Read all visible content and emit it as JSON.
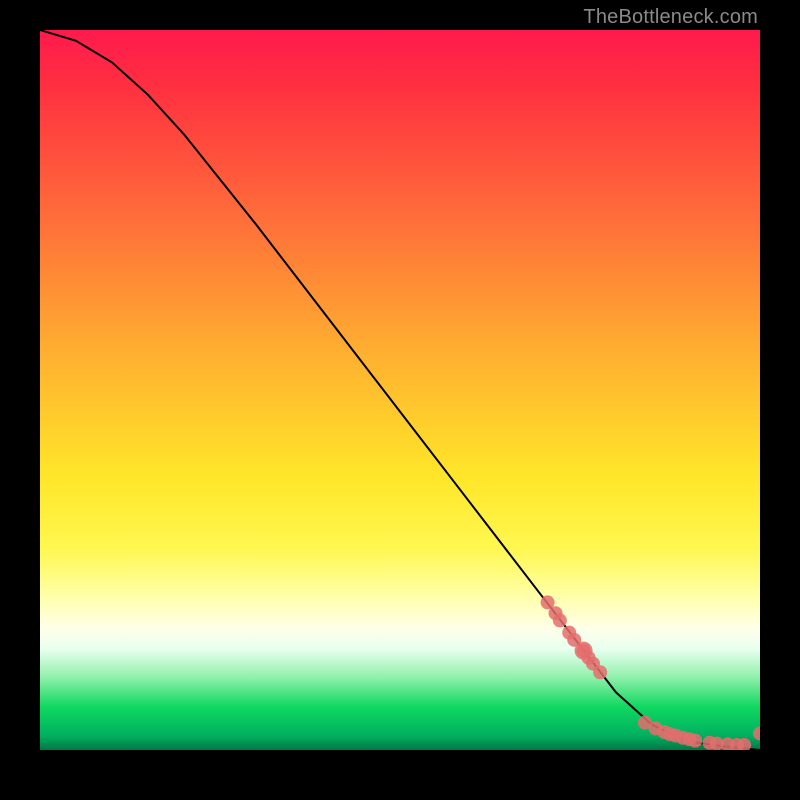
{
  "watermark": "TheBottleneck.com",
  "chart_data": {
    "type": "line",
    "title": "",
    "xlabel": "",
    "ylabel": "",
    "xlim": [
      0,
      1
    ],
    "ylim": [
      0,
      1
    ],
    "series": [
      {
        "name": "curve",
        "style": "line",
        "color": "#000000",
        "x": [
          0.0,
          0.05,
          0.1,
          0.15,
          0.2,
          0.3,
          0.4,
          0.5,
          0.6,
          0.7,
          0.75,
          0.8,
          0.85,
          0.9,
          0.95,
          1.0
        ],
        "y": [
          1.0,
          0.985,
          0.955,
          0.91,
          0.855,
          0.73,
          0.6,
          0.47,
          0.34,
          0.21,
          0.145,
          0.08,
          0.035,
          0.012,
          0.005,
          0.0
        ]
      },
      {
        "name": "points-upper",
        "style": "scatter",
        "color": "#e46d6d",
        "x": [
          0.705,
          0.716,
          0.722,
          0.735,
          0.742,
          0.755,
          0.762,
          0.768,
          0.778
        ],
        "y": [
          0.205,
          0.19,
          0.18,
          0.163,
          0.153,
          0.138,
          0.128,
          0.12,
          0.108
        ]
      },
      {
        "name": "star",
        "style": "scatter",
        "color": "#e46d6d",
        "x": [
          0.755
        ],
        "y": [
          0.138
        ]
      },
      {
        "name": "points-lower",
        "style": "scatter",
        "color": "#e46d6d",
        "x": [
          0.84,
          0.855,
          0.867,
          0.875,
          0.883,
          0.893,
          0.902,
          0.91,
          0.93,
          0.94,
          0.955,
          0.968,
          0.978,
          1.0
        ],
        "y": [
          0.038,
          0.03,
          0.025,
          0.022,
          0.02,
          0.017,
          0.015,
          0.013,
          0.01,
          0.009,
          0.008,
          0.007,
          0.007,
          0.023
        ]
      }
    ]
  }
}
